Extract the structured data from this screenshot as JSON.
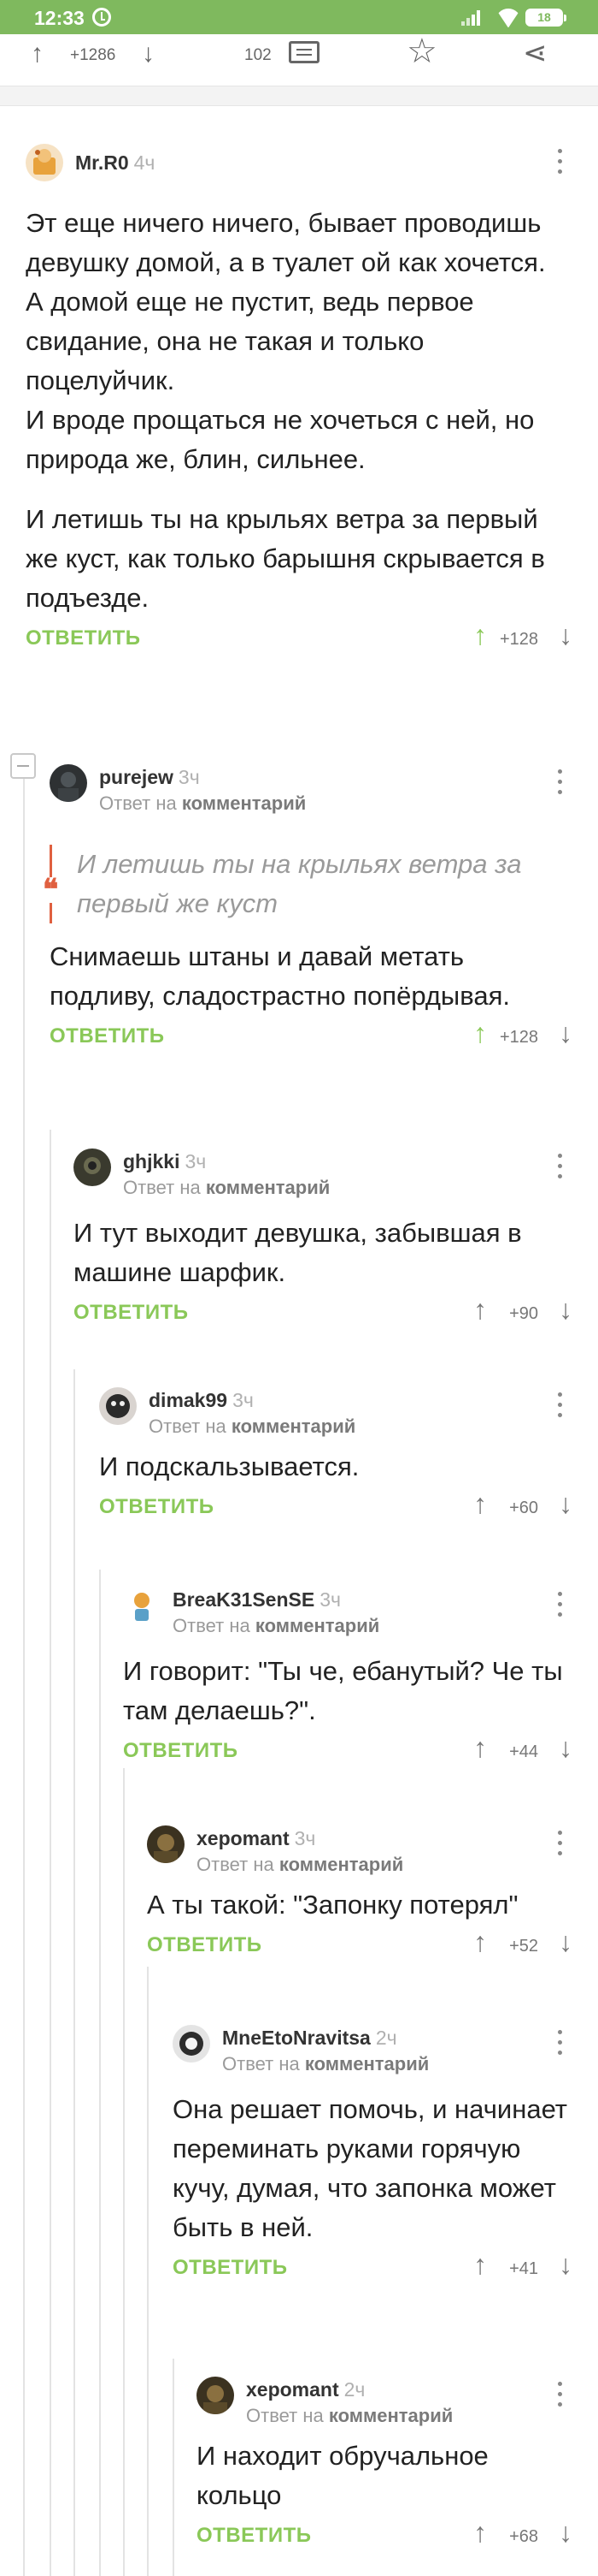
{
  "status_bar": {
    "time": "12:33",
    "battery": "18"
  },
  "post_bar": {
    "rating": "+1286",
    "comments_count": "102"
  },
  "comments": [
    {
      "author": "Mr.R0",
      "time": "4ч",
      "paragraphs": [
        "Эт еще ничего ничего, бывает проводишь девушку домой, а в туалет ой как хочется.",
        "А домой еще не пустит, ведь первое свидание, она не такая и только поцелуйчик.",
        "И вроде прощаться не хочеться с ней, но природа же, блин, сильнее."
      ],
      "paragraphs2": [
        "И летишь ты на крыльях ветра за первый же куст, как только барышня скрывается в подъезде."
      ],
      "reply_label": "ОТВЕТИТЬ",
      "votes": "+128"
    },
    {
      "author": "purejew",
      "time": "3ч",
      "reply_prefix": "Ответ на",
      "reply_target": "комментарий",
      "quote_mark": "❝",
      "quote": "И летишь ты на крыльях ветра за первый же куст",
      "body": "Снимаешь штаны и давай метать подливу, сладострастно попёрдывая.",
      "reply_label": "ОТВЕТИТЬ",
      "votes": "+128"
    },
    {
      "author": "ghjkki",
      "time": "3ч",
      "reply_prefix": "Ответ на",
      "reply_target": "комментарий",
      "body": "И тут выходит девушка, забывшая в машине шарфик.",
      "reply_label": "ОТВЕТИТЬ",
      "votes": "+90"
    },
    {
      "author": "dimak99",
      "time": "3ч",
      "reply_prefix": "Ответ на",
      "reply_target": "комментарий",
      "body": "И подскальзывается.",
      "reply_label": "ОТВЕТИТЬ",
      "votes": "+60"
    },
    {
      "author": "BreaK31SenSE",
      "time": "3ч",
      "reply_prefix": "Ответ на",
      "reply_target": "комментарий",
      "body": "И говорит: \"Ты че, ебанутый? Че ты там делаешь?\".",
      "reply_label": "ОТВЕТИТЬ",
      "votes": "+44"
    },
    {
      "author": "xepomant",
      "time": "3ч",
      "reply_prefix": "Ответ на",
      "reply_target": "комментарий",
      "body": "А ты такой: \"Запонку потерял\"",
      "reply_label": "ОТВЕТИТЬ",
      "votes": "+52"
    },
    {
      "author": "MneEtoNravitsa",
      "time": "2ч",
      "reply_prefix": "Ответ на",
      "reply_target": "комментарий",
      "body": "Она решает помочь, и начинает переминать руками горячую кучу, думая, что запонка может быть в ней.",
      "reply_label": "ОТВЕТИТЬ",
      "votes": "+41"
    },
    {
      "author": "xepomant",
      "time": "2ч",
      "reply_prefix": "Ответ на",
      "reply_target": "комментарий",
      "body": "И находит обручальное кольцо",
      "reply_label": "ОТВЕТИТЬ",
      "votes": "+68"
    }
  ],
  "colors": {
    "accent": "#8ac858",
    "status_bar": "#7fb95e",
    "quote": "#e06040"
  },
  "icons": [
    "alarm-icon",
    "signal-icon",
    "wifi-icon",
    "battery-icon",
    "upvote-icon",
    "downvote-icon",
    "comment-icon",
    "star-icon",
    "share-icon",
    "more-icon",
    "collapse-icon"
  ]
}
